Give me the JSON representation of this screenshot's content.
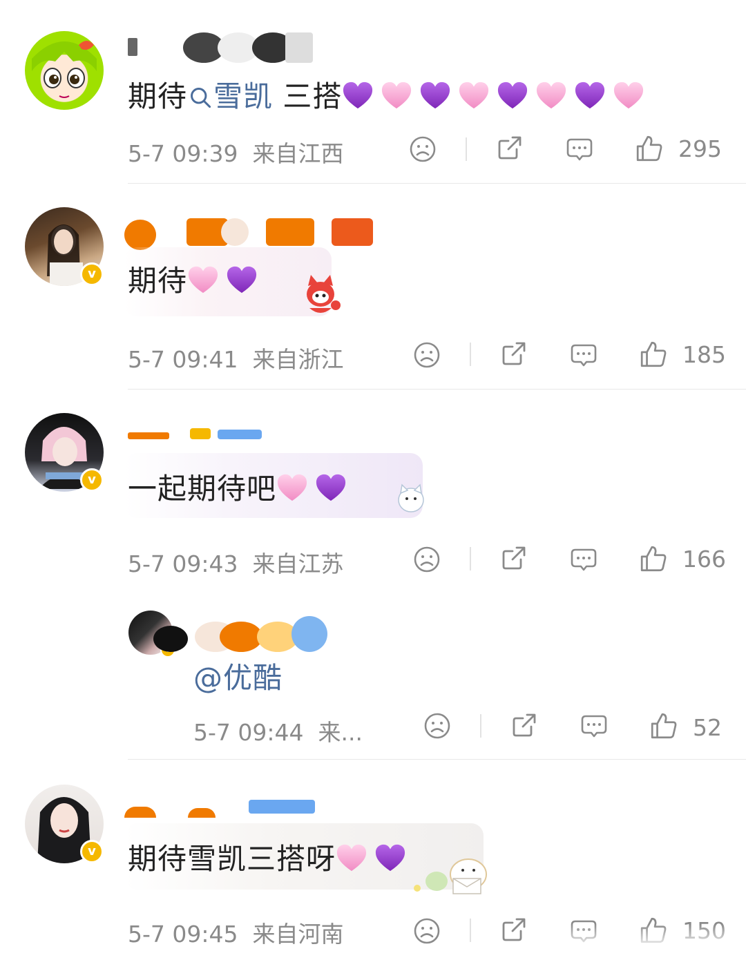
{
  "comments": [
    {
      "text": "期待",
      "topic": "雪凯",
      "text_after": " 三搭",
      "hearts": [
        "purple",
        "pink",
        "purple",
        "pink",
        "purple",
        "pink",
        "purple",
        "pink"
      ],
      "time": "5-7 09:39",
      "location": "来自江西",
      "likes": "295"
    },
    {
      "text": "期待",
      "hearts": [
        "pink",
        "purple"
      ],
      "time": "5-7 09:41",
      "location": "来自浙江",
      "likes": "185"
    },
    {
      "text": "一起期待吧",
      "hearts": [
        "pink",
        "purple"
      ],
      "time": "5-7 09:43",
      "location": "来自江苏",
      "likes": "166"
    },
    {
      "text": "@优酷",
      "time": "5-7 09:44",
      "location": "来...",
      "likes": "52"
    },
    {
      "text": "期待雪凯三搭呀",
      "hearts": [
        "pink",
        "purple"
      ],
      "time": "5-7 09:45",
      "location": "来自河南",
      "likes": "150"
    }
  ],
  "icons": {
    "dislike": "frown-icon",
    "share": "share-icon",
    "reply": "comment-icon",
    "like": "thumbs-up-icon",
    "verified": "verified-badge"
  },
  "badge_letter": "v",
  "colors": {
    "text": "#222222",
    "meta": "#8a8a8a",
    "link": "#4a6c9b",
    "verified": "#f5b800",
    "heart_pink": "#f7a8d4",
    "heart_purple": "#9b3fd1"
  }
}
